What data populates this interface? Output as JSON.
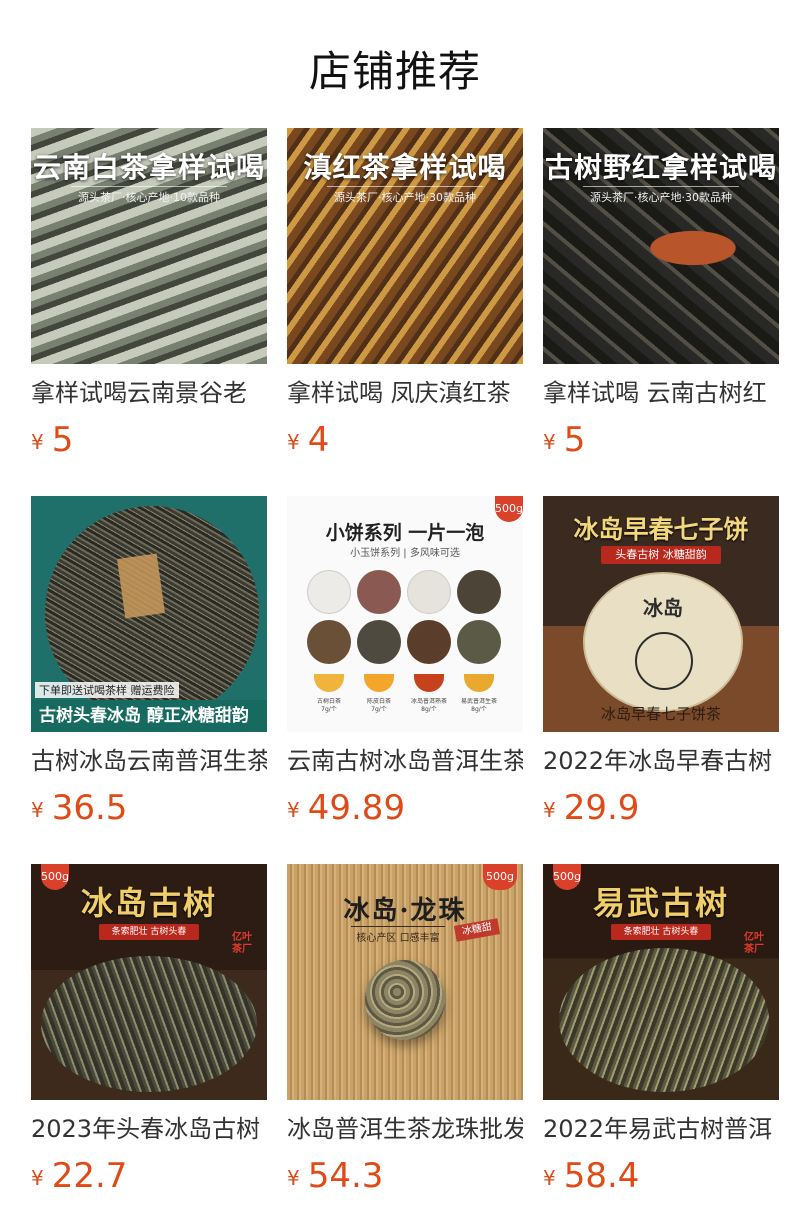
{
  "header": {
    "title": "店铺推荐"
  },
  "products": [
    {
      "name": "拿样试喝云南景谷老",
      "currency": "¥",
      "price": "5",
      "thumb": {
        "title": "云南白茶拿样试喝",
        "sub": "源头茶厂·核心产地·10款品种",
        "bg": "white-tea"
      }
    },
    {
      "name": "拿样试喝 凤庆滇红茶",
      "currency": "¥",
      "price": "4",
      "thumb": {
        "title": "滇红茶拿样试喝",
        "sub": "源头茶厂·核心产地·30款品种",
        "bg": "red-tea"
      }
    },
    {
      "name": "拿样试喝 云南古树红",
      "currency": "¥",
      "price": "5",
      "thumb": {
        "title": "古树野红拿样试喝",
        "sub": "源头茶厂·核心产地·30款品种",
        "bg": "wild-red"
      }
    },
    {
      "name": "古树冰岛云南普洱生茶",
      "currency": "¥",
      "price": "36.5",
      "thumb": {
        "title": "",
        "banner": "古树头春冰岛 醇正冰糖甜韵",
        "note": "下单即送试喝茶样 赠运费险",
        "bg": "cake-green"
      }
    },
    {
      "name": "云南古树冰岛普洱生茶",
      "currency": "¥",
      "price": "49.89",
      "thumb": {
        "title": "小饼系列 一片一泡",
        "sub": "小玉饼系列 | 多风味可选",
        "tag": "500g",
        "captions": [
          "古树白茶",
          "陈皮白茶",
          "冰岛普洱熟茶",
          "易武普洱生茶"
        ],
        "weights": [
          "7g/个",
          "7g/个",
          "8g/个",
          "8g/个"
        ],
        "bg": "mini-cakes"
      }
    },
    {
      "name": "2022年冰岛早春古树",
      "currency": "¥",
      "price": "29.9",
      "thumb": {
        "title": "冰岛早春七子饼",
        "sub": "头春古树 冰糖甜韵",
        "cake": "冰岛",
        "bottom": "冰岛早春七子饼茶",
        "bg": "cake-brown"
      }
    },
    {
      "name": "2023年头春冰岛古树",
      "currency": "¥",
      "price": "22.7",
      "thumb": {
        "title": "冰岛古树",
        "sub": "条索肥壮 古树头春",
        "tag": "500g",
        "brand": "亿叶茶厂",
        "bg": "loose-leaf"
      }
    },
    {
      "name": "冰岛普洱生茶龙珠批发",
      "currency": "¥",
      "price": "54.3",
      "thumb": {
        "title": "冰岛·龙珠",
        "sub": "核心产区 口感丰富",
        "tag": "500g",
        "stamp": "冰糖甜",
        "bg": "dragon-ball"
      }
    },
    {
      "name": "2022年易武古树普洱",
      "currency": "¥",
      "price": "58.4",
      "thumb": {
        "title": "易武古树",
        "sub": "条索肥壮 古树头春",
        "tag": "500g",
        "brand": "亿叶茶厂",
        "bg": "loose-leaf-2"
      }
    }
  ],
  "colors": {
    "price": "#e04a17",
    "title": "#111111",
    "text": "#333333"
  }
}
